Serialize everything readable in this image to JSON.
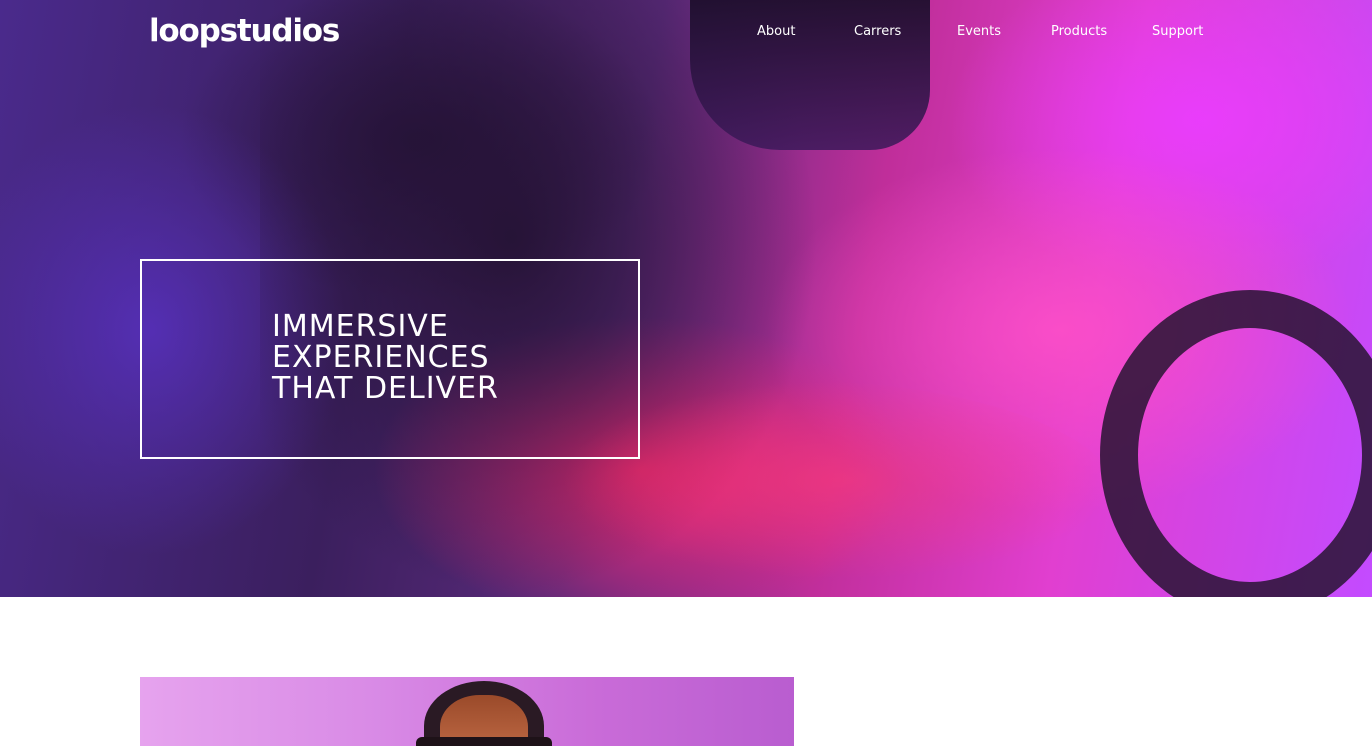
{
  "brand": {
    "logo_text": "loopstudios"
  },
  "nav": {
    "items": [
      {
        "label": "About"
      },
      {
        "label": "Carrers"
      },
      {
        "label": "Events"
      },
      {
        "label": "Products"
      },
      {
        "label": "Support"
      }
    ]
  },
  "hero": {
    "headline_lines": [
      "IMMERSIVE",
      "EXPERIENCES",
      "THAT DELIVER"
    ]
  },
  "colors": {
    "text_on_hero": "#ffffff",
    "page_background": "#ffffff",
    "hero_accent_pink": "#e13fd0",
    "hero_accent_violet": "#c34bff"
  },
  "icons": {
    "logo": "wordmark-logo"
  }
}
